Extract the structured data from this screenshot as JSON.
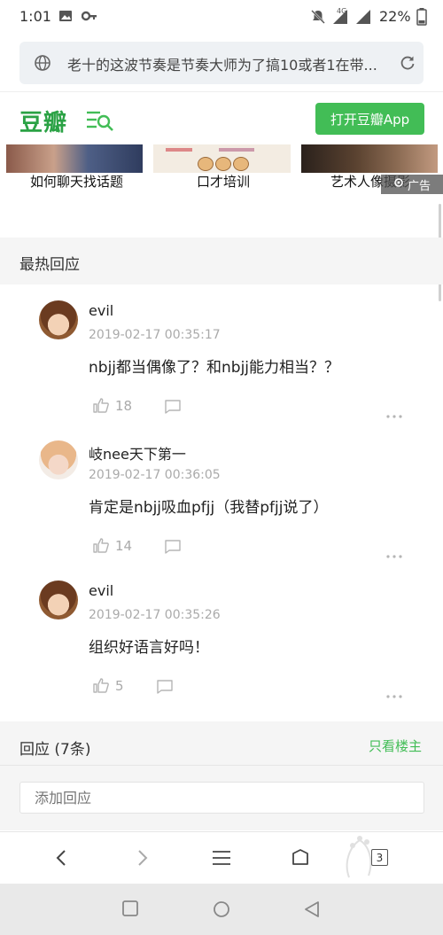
{
  "status_bar": {
    "time": "1:01",
    "network_label": "4G",
    "battery_percent": "22%",
    "icons": [
      "image-icon",
      "key-icon",
      "mute-icon",
      "signal-icon",
      "battery-icon"
    ]
  },
  "url_bar": {
    "url_text": "老十的这波节奏是节奏大师为了搞10或者1在带..."
  },
  "header": {
    "logo": "豆瓣",
    "open_app_label": "打开豆瓣App",
    "brand_color": "#42bd56"
  },
  "ads": {
    "items": [
      {
        "caption": "如何聊天找话题"
      },
      {
        "caption": "口才培训"
      },
      {
        "caption": "艺术人像摄影"
      }
    ],
    "ad_label": "广告"
  },
  "hot_replies": {
    "title": "最热回应",
    "comments": [
      {
        "username": "evil",
        "timestamp": "2019-02-17 00:35:17",
        "content": "nbjj都当偶像了？和nbjj能力相当？？",
        "likes": "18"
      },
      {
        "username": "岐nee天下第一",
        "timestamp": "2019-02-17 00:36:05",
        "content": "肯定是nbjj吸血pfjj（我替pfjj说了）",
        "likes": "14"
      },
      {
        "username": "evil",
        "timestamp": "2019-02-17 00:35:26",
        "content": "组织好语言好吗！",
        "likes": "5"
      }
    ]
  },
  "replies": {
    "count_label": "回应 (7条)",
    "only_op_label": "只看楼主",
    "input_placeholder": "添加回应"
  },
  "browser_nav": {
    "tab_count": "3"
  }
}
